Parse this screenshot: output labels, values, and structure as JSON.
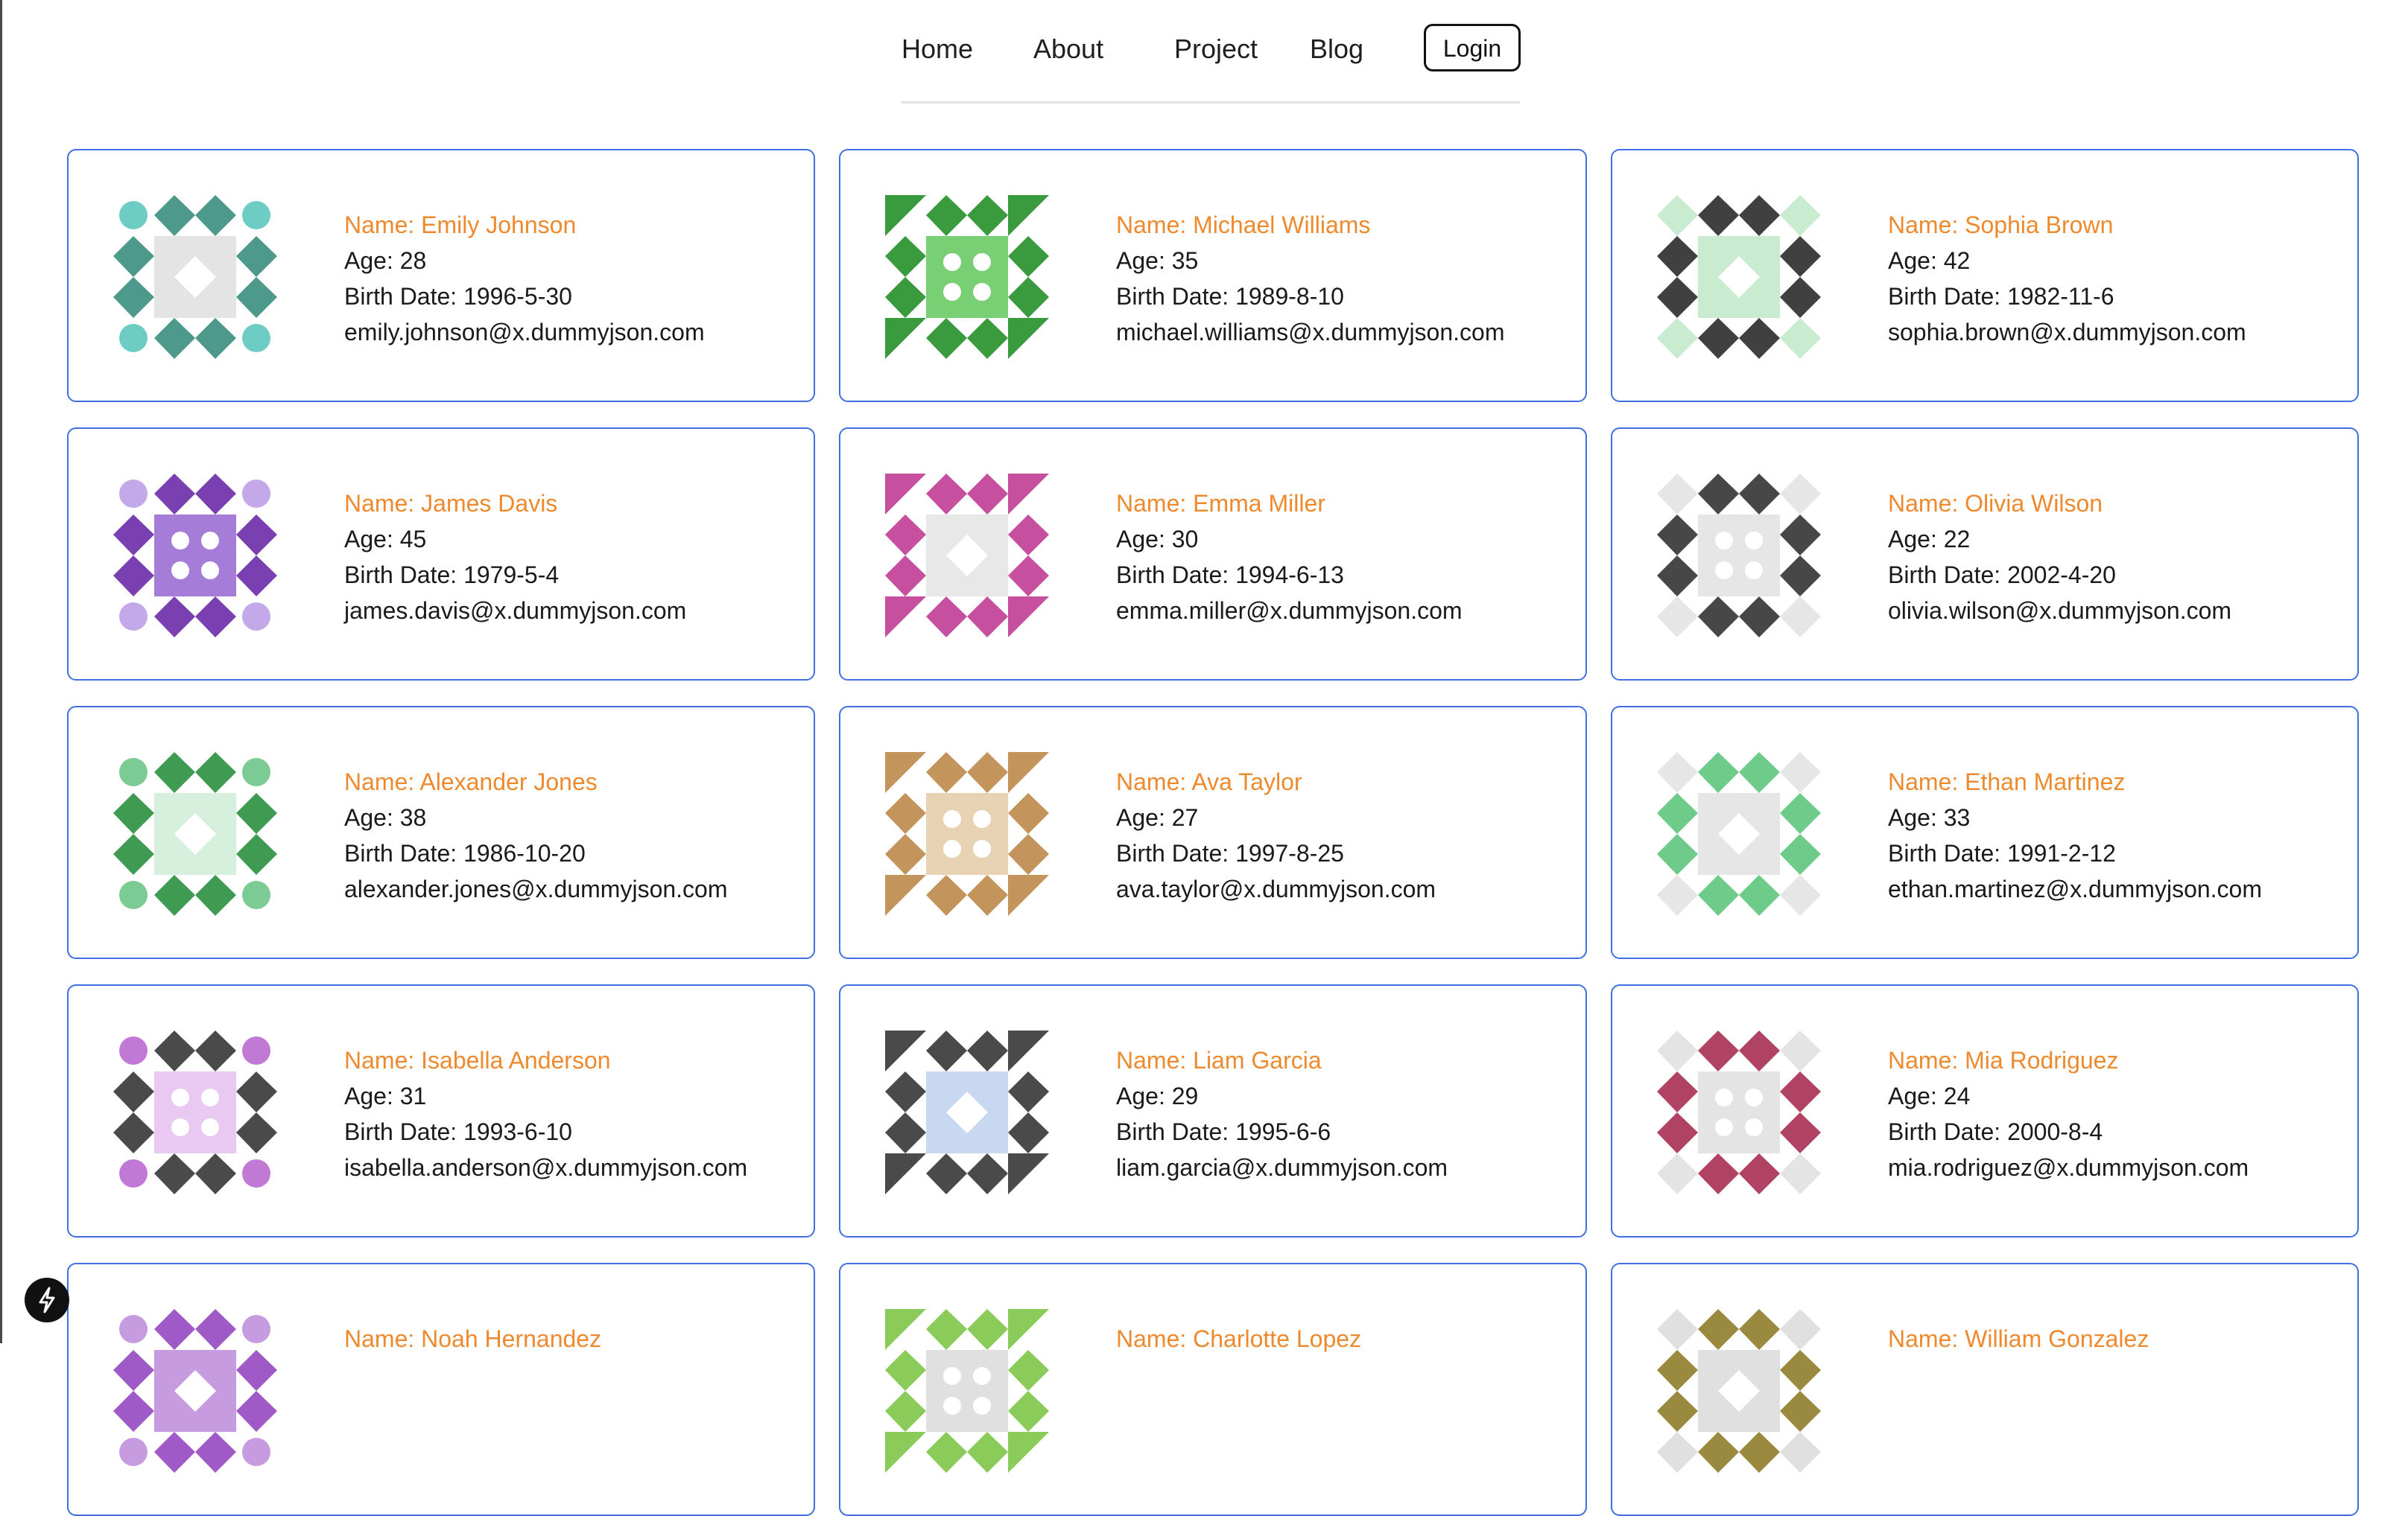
{
  "nav": {
    "links": [
      "Home",
      "About",
      "Project",
      "Blog"
    ],
    "login_label": "Login"
  },
  "users": [
    {
      "name": "Name: Emily Johnson",
      "age": "Age: 28",
      "birth": "Birth Date: 1996-5-30",
      "email": "emily.johnson@x.dummyjson.com",
      "colors": [
        "#4d9a8d",
        "#6dcdc4",
        "#e4e4e4"
      ]
    },
    {
      "name": "Name: Michael Williams",
      "age": "Age: 35",
      "birth": "Birth Date: 1989-8-10",
      "email": "michael.williams@x.dummyjson.com",
      "colors": [
        "#3a9a3e",
        "#79cf74",
        "#ffffff"
      ]
    },
    {
      "name": "Name: Sophia Brown",
      "age": "Age: 42",
      "birth": "Birth Date: 1982-11-6",
      "email": "sophia.brown@x.dummyjson.com",
      "colors": [
        "#404040",
        "#7ccf86",
        "#c9ebd0"
      ]
    },
    {
      "name": "Name: James Davis",
      "age": "Age: 45",
      "birth": "Birth Date: 1979-5-4",
      "email": "james.davis@x.dummyjson.com",
      "colors": [
        "#7a3fb0",
        "#c3a8ea",
        "#a57cd8"
      ]
    },
    {
      "name": "Name: Emma Miller",
      "age": "Age: 30",
      "birth": "Birth Date: 1994-6-13",
      "email": "emma.miller@x.dummyjson.com",
      "colors": [
        "#c64fa0",
        "#c67fb6",
        "#e8e8e8"
      ]
    },
    {
      "name": "Name: Olivia Wilson",
      "age": "Age: 22",
      "birth": "Birth Date: 2002-4-20",
      "email": "olivia.wilson@x.dummyjson.com",
      "colors": [
        "#474747",
        "#67c25a",
        "#e6e6e6"
      ]
    },
    {
      "name": "Name: Alexander Jones",
      "age": "Age: 38",
      "birth": "Birth Date: 1986-10-20",
      "email": "alexander.jones@x.dummyjson.com",
      "colors": [
        "#3f9a52",
        "#7ccb94",
        "#d7f0de"
      ]
    },
    {
      "name": "Name: Ava Taylor",
      "age": "Age: 27",
      "birth": "Birth Date: 1997-8-25",
      "email": "ava.taylor@x.dummyjson.com",
      "colors": [
        "#c3955c",
        "#a9814f",
        "#e8d2b4"
      ]
    },
    {
      "name": "Name: Ethan Martinez",
      "age": "Age: 33",
      "birth": "Birth Date: 1991-2-12",
      "email": "ethan.martinez@x.dummyjson.com",
      "colors": [
        "#6fcb8a",
        "#e6e6e6",
        "#ffffff"
      ]
    },
    {
      "name": "Name: Isabella Anderson",
      "age": "Age: 31",
      "birth": "Birth Date: 1993-6-10",
      "email": "isabella.anderson@x.dummyjson.com",
      "colors": [
        "#4a4a4a",
        "#c07ad6",
        "#e9c8f2"
      ]
    },
    {
      "name": "Name: Liam Garcia",
      "age": "Age: 29",
      "birth": "Birth Date: 1995-6-6",
      "email": "liam.garcia@x.dummyjson.com",
      "colors": [
        "#4a4a4a",
        "#7aa0d8",
        "#c8d8f0"
      ]
    },
    {
      "name": "Name: Mia Rodriguez",
      "age": "Age: 24",
      "birth": "Birth Date: 2000-8-4",
      "email": "mia.rodriguez@x.dummyjson.com",
      "colors": [
        "#b04263",
        "#d07a98",
        "#e4e4e4"
      ]
    },
    {
      "name": "Name: Noah Hernandez",
      "age": "",
      "birth": "",
      "email": "",
      "colors": [
        "#a05ac8",
        "#c79be0",
        "#ffffff"
      ]
    },
    {
      "name": "Name: Charlotte Lopez",
      "age": "",
      "birth": "",
      "email": "",
      "colors": [
        "#8acb5a",
        "#e0e0e0",
        "#ffffff"
      ]
    },
    {
      "name": "Name: William Gonzalez",
      "age": "",
      "birth": "",
      "email": "",
      "colors": [
        "#9a8a40",
        "#e0e0e0",
        "#ffffff"
      ]
    }
  ],
  "fab_icon": "bolt-icon"
}
